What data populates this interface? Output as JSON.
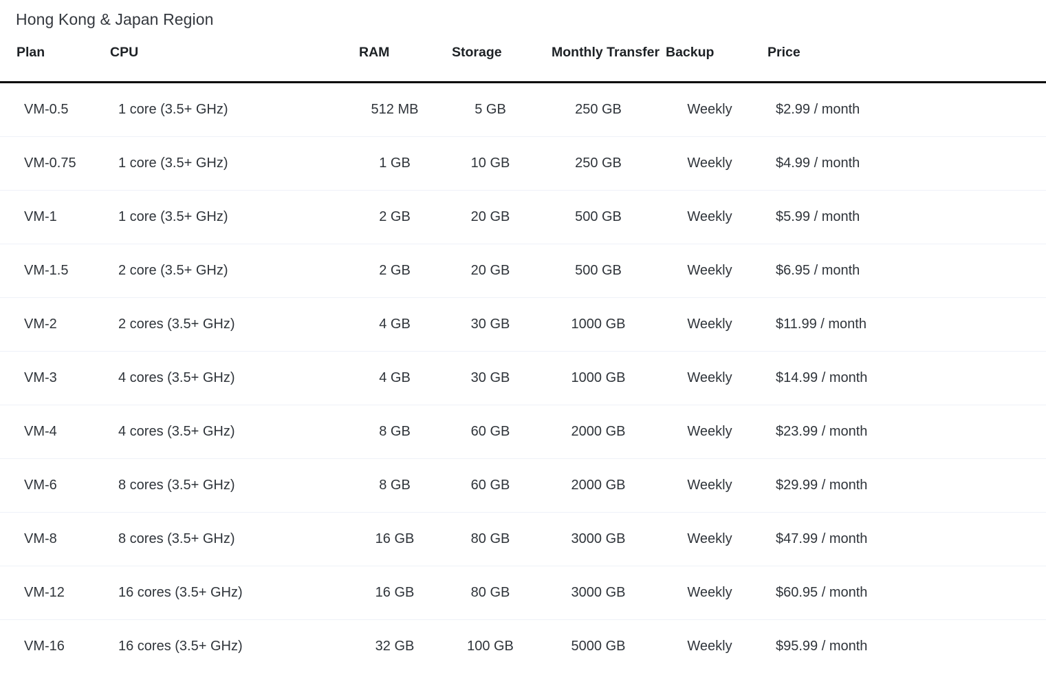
{
  "page": {
    "region_title": "Hong Kong & Japan Region"
  },
  "table": {
    "columns": [
      {
        "key": "plan",
        "label": "Plan"
      },
      {
        "key": "cpu",
        "label": "CPU"
      },
      {
        "key": "ram",
        "label": "RAM"
      },
      {
        "key": "storage",
        "label": "Storage"
      },
      {
        "key": "transfer",
        "label": "Monthly Transfer"
      },
      {
        "key": "backup",
        "label": "Backup"
      },
      {
        "key": "price",
        "label": "Price"
      }
    ],
    "rows": [
      {
        "plan": "VM-0.5",
        "cpu": "1 core (3.5+ GHz)",
        "ram": "512 MB",
        "storage": "5 GB",
        "transfer": "250 GB",
        "backup": "Weekly",
        "price": "$2.99 / month"
      },
      {
        "plan": "VM-0.75",
        "cpu": "1 core (3.5+ GHz)",
        "ram": "1 GB",
        "storage": "10 GB",
        "transfer": "250 GB",
        "backup": "Weekly",
        "price": "$4.99 / month"
      },
      {
        "plan": "VM-1",
        "cpu": "1 core (3.5+ GHz)",
        "ram": "2 GB",
        "storage": "20 GB",
        "transfer": "500 GB",
        "backup": "Weekly",
        "price": "$5.99 / month"
      },
      {
        "plan": "VM-1.5",
        "cpu": "2 core (3.5+ GHz)",
        "ram": "2 GB",
        "storage": "20 GB",
        "transfer": "500 GB",
        "backup": "Weekly",
        "price": "$6.95 / month"
      },
      {
        "plan": "VM-2",
        "cpu": "2 cores (3.5+ GHz)",
        "ram": "4 GB",
        "storage": "30 GB",
        "transfer": "1000 GB",
        "backup": "Weekly",
        "price": "$11.99 / month"
      },
      {
        "plan": "VM-3",
        "cpu": "4 cores (3.5+ GHz)",
        "ram": "4 GB",
        "storage": "30 GB",
        "transfer": "1000 GB",
        "backup": "Weekly",
        "price": "$14.99 / month"
      },
      {
        "plan": "VM-4",
        "cpu": "4 cores (3.5+ GHz)",
        "ram": "8 GB",
        "storage": "60 GB",
        "transfer": "2000 GB",
        "backup": "Weekly",
        "price": "$23.99 / month"
      },
      {
        "plan": "VM-6",
        "cpu": "8 cores (3.5+ GHz)",
        "ram": "8 GB",
        "storage": "60 GB",
        "transfer": "2000 GB",
        "backup": "Weekly",
        "price": "$29.99 / month"
      },
      {
        "plan": "VM-8",
        "cpu": "8 cores (3.5+ GHz)",
        "ram": "16 GB",
        "storage": "80 GB",
        "transfer": "3000 GB",
        "backup": "Weekly",
        "price": "$47.99 / month"
      },
      {
        "plan": "VM-12",
        "cpu": "16 cores (3.5+ GHz)",
        "ram": "16 GB",
        "storage": "80 GB",
        "transfer": "3000 GB",
        "backup": "Weekly",
        "price": "$60.95 / month"
      },
      {
        "plan": "VM-16",
        "cpu": "16 cores (3.5+ GHz)",
        "ram": "32 GB",
        "storage": "100 GB",
        "transfer": "5000 GB",
        "backup": "Weekly",
        "price": "$95.99 / month"
      }
    ]
  },
  "colors": {
    "text": "#2f343a",
    "heading": "#1d2125",
    "title": "#34383e",
    "header_rule": "#000000",
    "row_divider": "#eef1f8",
    "background": "#ffffff"
  }
}
